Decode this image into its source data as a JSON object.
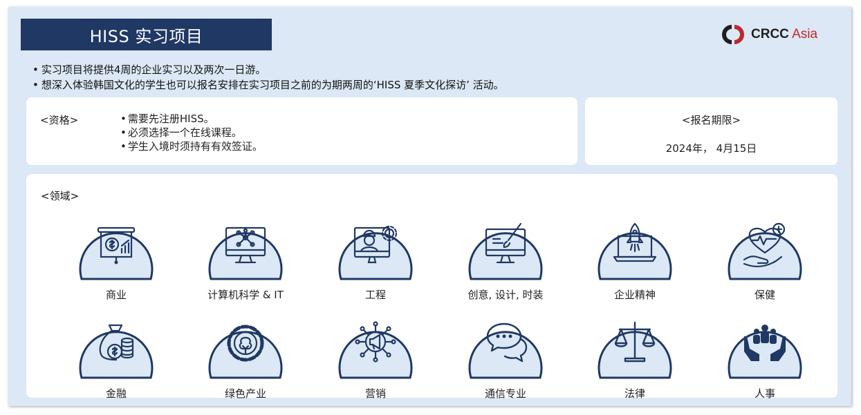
{
  "header": {
    "title": "HISS 实习项目"
  },
  "logo": {
    "text_main": "CRCC",
    "text_accent": "Asia"
  },
  "bullets": [
    "实习项目将提供4周的企业实习以及两次一日游。",
    "想深入体验韩国文化的学生也可以报名安排在实习项目之前的为期两周的‘HISS 夏季文化探访’ 活动。"
  ],
  "eligibility": {
    "label": "<资格>",
    "items": [
      "需要先注册HISS。",
      "必须选择一个在线课程。",
      "学生入境时须持有有效签证。"
    ]
  },
  "deadline": {
    "label": "<报名期限>",
    "date": "2024年， 4月15日"
  },
  "fields": {
    "label": "<领域>",
    "items": [
      {
        "name": "商业",
        "icon": "business-presentation-icon"
      },
      {
        "name": "计算机科学 & IT",
        "icon": "computer-network-icon"
      },
      {
        "name": "工程",
        "icon": "engineer-gear-icon"
      },
      {
        "name": "创意, 设计, 时装",
        "icon": "design-monitor-icon"
      },
      {
        "name": "企业精神",
        "icon": "rocket-laptop-icon"
      },
      {
        "name": "保健",
        "icon": "health-heart-icon"
      },
      {
        "name": "金融",
        "icon": "money-bag-icon"
      },
      {
        "name": "绿色产业",
        "icon": "eco-gear-icon"
      },
      {
        "name": "营销",
        "icon": "megaphone-network-icon"
      },
      {
        "name": "通信专业",
        "icon": "chat-bubbles-icon"
      },
      {
        "name": "法律",
        "icon": "scales-icon"
      },
      {
        "name": "人事",
        "icon": "people-hands-icon"
      }
    ]
  },
  "colors": {
    "navy": "#1f3864",
    "icon_fill": "#dce8f5",
    "background": "#dce8f5",
    "logo_red": "#c0272d"
  }
}
